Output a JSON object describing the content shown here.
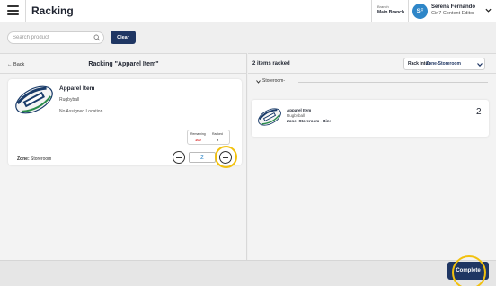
{
  "header": {
    "title": "Racking",
    "branch_label": "Branch",
    "branch_name": "Main Branch",
    "user_initials": "SF",
    "user_name": "Serena Fernando",
    "user_role": "Cin7 Content Editor"
  },
  "toolbar": {
    "search_placeholder": "Search product",
    "search_value": "",
    "clear_label": "Clear"
  },
  "left_panel": {
    "back_label": "Back",
    "title": "Racking \"Apparel Item\"",
    "item": {
      "name": "Apparel Item",
      "subtitle": "Rugbyball",
      "location": "No Assigned Location",
      "remaining_label": "Remaining",
      "racked_label": "Racked",
      "remaining_value": "100",
      "racked_value": "2",
      "zone_label": "Zone:",
      "zone_value": "Storeroom",
      "quantity": "2"
    }
  },
  "right_panel": {
    "racked_count": "2 items racked",
    "rack_into_label": "Rack into:",
    "rack_into_value": "Zone-Storeroom",
    "group_label": "Storeroom-",
    "racked_item": {
      "name": "Apparel Item",
      "subtitle": "Rugbyball",
      "zone": "Zone: Storeroom - Bin:",
      "quantity": "2"
    }
  },
  "footer": {
    "complete_label": "Complete"
  },
  "colors": {
    "primary": "#1f3663",
    "accent_blue": "#2e86c8",
    "highlight": "#f2c10e",
    "remaining_red": "#d92b2b"
  }
}
